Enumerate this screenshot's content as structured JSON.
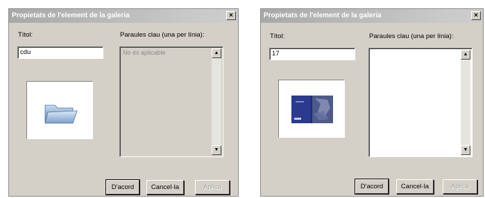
{
  "dialogs": [
    {
      "title": "Propietats de l'element de la galeria",
      "close_label": "×",
      "title_label": "Títol:",
      "title_value": "cdu",
      "keywords_label": "Paraules clau (una per línia):",
      "keywords_text": "No és aplicable",
      "keywords_enabled": false,
      "preview_icon": "folder-icon",
      "scroll_up": "▲",
      "scroll_down": "▼",
      "ok_label": "D'acord",
      "cancel_label": "Cancel·la",
      "apply_label": "Aplica"
    },
    {
      "title": "Propietats de l'element de la galeria",
      "close_label": "×",
      "title_label": "Títol:",
      "title_value": "17",
      "keywords_label": "Paraules clau (una per línia):",
      "keywords_text": "",
      "keywords_enabled": true,
      "preview_icon": "book-cover-thumbnail",
      "scroll_up": "▲",
      "scroll_down": "▼",
      "ok_label": "D'acord",
      "cancel_label": "Cancel·la",
      "apply_label": "Aplica"
    }
  ]
}
